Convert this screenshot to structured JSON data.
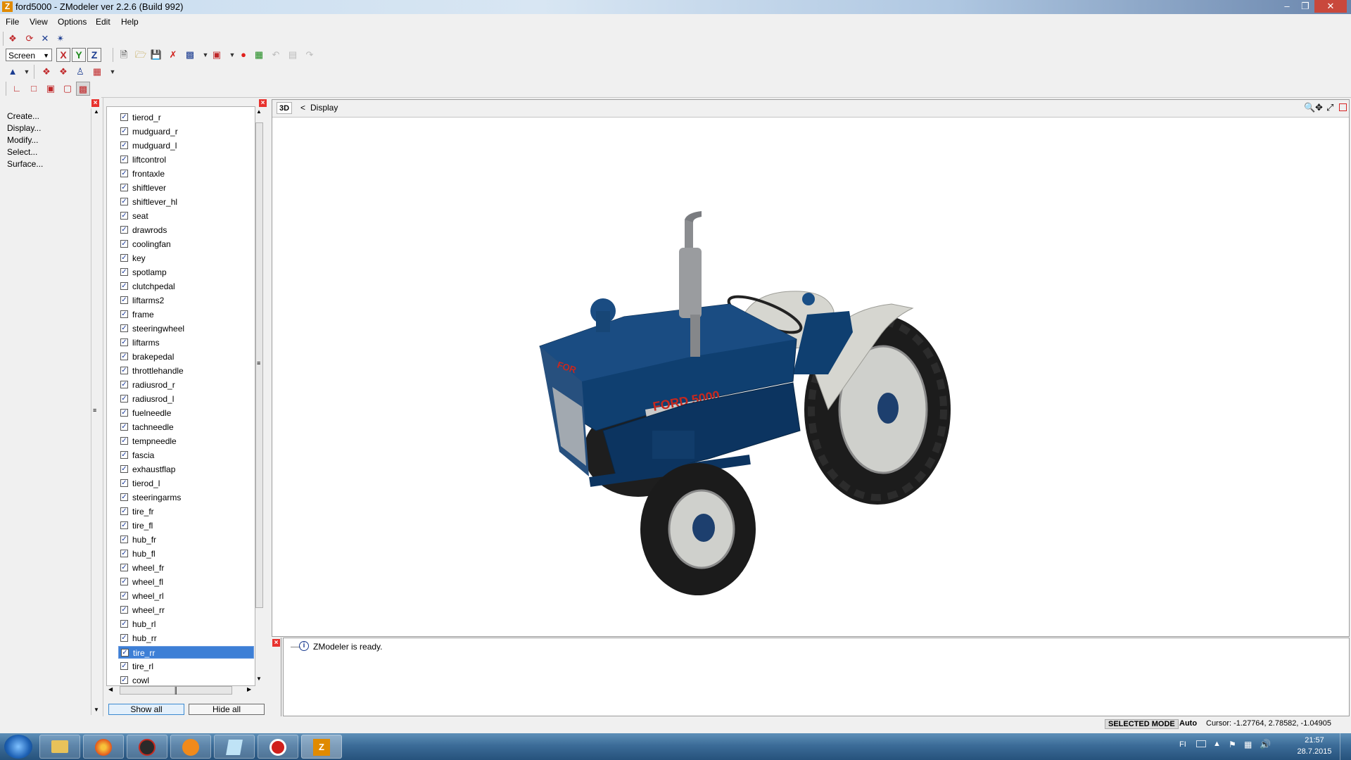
{
  "window": {
    "title": "ford5000 - ZModeler ver 2.2.6 (Build 992)",
    "app_icon_letter": "Z"
  },
  "menu": [
    "File",
    "View",
    "Options",
    "Edit",
    "Help"
  ],
  "toolbar": {
    "coord_mode": "Screen",
    "axes": [
      "X",
      "Y",
      "Z"
    ]
  },
  "commands": [
    "Create...",
    "Display...",
    "Modify...",
    "Select...",
    "Surface..."
  ],
  "hierarchy": {
    "items": [
      "tierod_r",
      "mudguard_r",
      "mudguard_l",
      "liftcontrol",
      "frontaxle",
      "shiftlever",
      "shiftlever_hl",
      "seat",
      "drawrods",
      "coolingfan",
      "key",
      "spotlamp",
      "clutchpedal",
      "liftarms2",
      "frame",
      "steeringwheel",
      "liftarms",
      "brakepedal",
      "throttlehandle",
      "radiusrod_r",
      "radiusrod_l",
      "fuelneedle",
      "tachneedle",
      "tempneedle",
      "fascia",
      "exhaustflap",
      "tierod_l",
      "steeringarms",
      "tire_fr",
      "tire_fl",
      "hub_fr",
      "hub_fl",
      "wheel_fr",
      "wheel_fl",
      "wheel_rl",
      "wheel_rr",
      "hub_rl",
      "hub_rr",
      "tire_rr",
      "tire_rl",
      "cowl"
    ],
    "selected": "tire_rr",
    "show_all": "Show all",
    "hide_all": "Hide all",
    "check_glyph": "✓"
  },
  "viewport": {
    "mode_label": "3D",
    "back_glyph": "<",
    "title": "Display",
    "brand_text": "FORD 5000",
    "grille_text": "FOR"
  },
  "log": {
    "message": "ZModeler is ready."
  },
  "status": {
    "mode": "SELECTED MODE",
    "snap": "Auto",
    "cursor": "Cursor: -1.27764, 2.78582, -1.04905"
  },
  "taskbar": {
    "lang": "FI",
    "time": "21:57",
    "date": "28.7.2015"
  },
  "colors": {
    "tractor_blue": "#0f3f70",
    "tractor_grey": "#d6d6d0",
    "selection": "#cfe3fb"
  }
}
